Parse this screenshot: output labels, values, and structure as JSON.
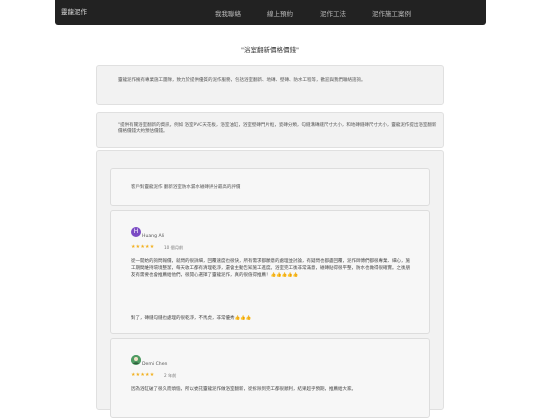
{
  "navbar": {
    "brand": "靈龍泥作",
    "links": [
      "我我聯絡",
      "線上預約",
      "泥作工法",
      "泥作施工案例"
    ]
  },
  "page_title": "\"浴室翻新價格價錢\"",
  "info_panels": [
    "靈龍泥作擁有專業施工團隊，致力於提供優質的泥作服務，包括浴室翻新、地磚、壁磚、防水工程等，歡迎與我們聯絡諮詢。",
    "\"提供有關浴室翻新的資訊，例如 浴室PVC天花板，浴室油缸，浴室壁磚門片框，瓷磚分類，勾縫溝磚縫尺寸大小，和地磚縫磚尺寸大小，靈龍泥作提出浴室翻新價格價錢大約預估價錢。"
  ],
  "reviews_heading": "客戶對靈龍泥作 翻新浴室防水漏水磁磚評分最高的評價",
  "reviews": [
    {
      "avatar_letter": "H",
      "avatar_color": "#7b4bc4",
      "name": "Huang Ali",
      "stars": "★★★★★",
      "time": "10 個月前",
      "text": "從一開始的詢問報價，就問的很詳細，回覆速度也很快，所有需求都願意的處理並討論，有疑問也都盡回覆，泥作師傅們都很專業、細心，施工期間維持環境整潔，每天收工都有清理乾淨，還會主動告知施工進度。浴室完工後非常滿意，磁磚貼得很平整，防水也做得很確實。之後朋友有需要也會推薦給他們，很開心選擇了靈龍泥作，真的很值得推薦！👍👍👍👍👍",
      "text2": "對了，磚縫勾縫也處理的很乾淨，不馬虎，非常優秀👍👍👍"
    },
    {
      "avatar_letter": "",
      "avatar_color": "#3e8e5a",
      "name": "Demi Chen",
      "stars": "★★★★★",
      "time": "2 年前",
      "text": "因為浴缸破了很久而煩惱，所以委託靈龍泥作做浴室翻新，從拆除到完工都很順利，結果超乎預期，推薦給大家。",
      "text2": ""
    }
  ]
}
